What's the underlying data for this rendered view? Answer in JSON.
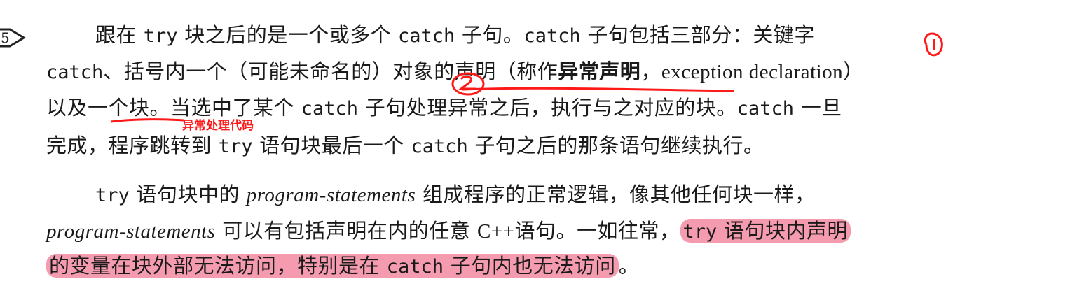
{
  "paragraph1": {
    "line1": {
      "a": "跟在 ",
      "b": "try",
      "c": " 块之后的是一个或多个 ",
      "d": "catch",
      "e": " 子句。",
      "f": "catch",
      "g": " 子句包括三部分：关键字"
    },
    "line2": {
      "a": "catch",
      "b": "、括号内一个（可能未命名的）对象的声明（称作",
      "c": "异常声明",
      "d": "，",
      "e": "exception declaration",
      "f": "）"
    },
    "line3": {
      "a": "以及一个块。当选中了某个 ",
      "b": "catch",
      "c": " 子句处理异常之后，执行与之对应的块。",
      "d": "catch",
      "e": " 一旦"
    },
    "line4": {
      "a": "完成，程序跳转到 ",
      "b": "try",
      "c": " 语句块最后一个 ",
      "d": "catch",
      "e": " 子句之后的那条语句继续执行。"
    }
  },
  "paragraph2": {
    "line1": {
      "a": "try",
      "b": " 语句块中的 ",
      "c": "program-statements",
      "d": " 组成程序的正常逻辑，像其他任何块一样，"
    },
    "line2": {
      "a": "program-statements",
      "b": " 可以有包括声明在内的任意 ",
      "c": "C++",
      "d": "语句。一如往常，",
      "e": "try",
      "f": " 语句块内声明"
    },
    "line3": {
      "a": "的变量在块外部无法访问，特别是在 ",
      "b": "catch",
      "c": " 子句内也无法访问",
      "d": "。"
    }
  },
  "annotations": {
    "note": "异常处理代码",
    "color_red": "#ff1a1a",
    "color_highlight": "#ec486e"
  }
}
